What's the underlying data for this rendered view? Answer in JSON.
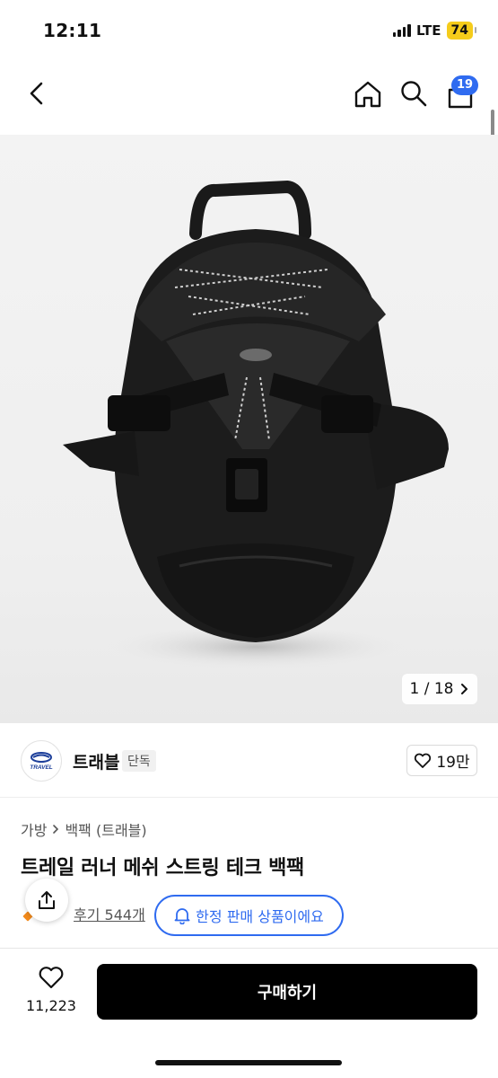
{
  "status_bar": {
    "time": "12:11",
    "network": "LTE",
    "battery": "74"
  },
  "nav": {
    "back_icon": "chevron-left-icon",
    "home_icon": "home-icon",
    "search_icon": "search-icon",
    "cart_icon": "shopping-bag-icon",
    "cart_count": "19"
  },
  "gallery": {
    "current": "1",
    "total": "18",
    "counter_text": "1 / 18"
  },
  "brand": {
    "name": "트래블",
    "badge": "단독",
    "logo_text": "TRAVEL",
    "likes": "19만"
  },
  "product": {
    "breadcrumb": [
      "가방",
      "백팩 (트래블)"
    ],
    "title": "트레일 러너 메쉬 스트링 테크 백팩",
    "review_link": "후기 544개",
    "limited_notice": "한정 판매 상품이에요"
  },
  "bottom_bar": {
    "wish_count": "11,223",
    "buy_label": "구매하기"
  },
  "colors": {
    "accent_blue": "#2f6bf0",
    "buy_button": "#000000",
    "battery_yellow": "#f5cc1b"
  }
}
